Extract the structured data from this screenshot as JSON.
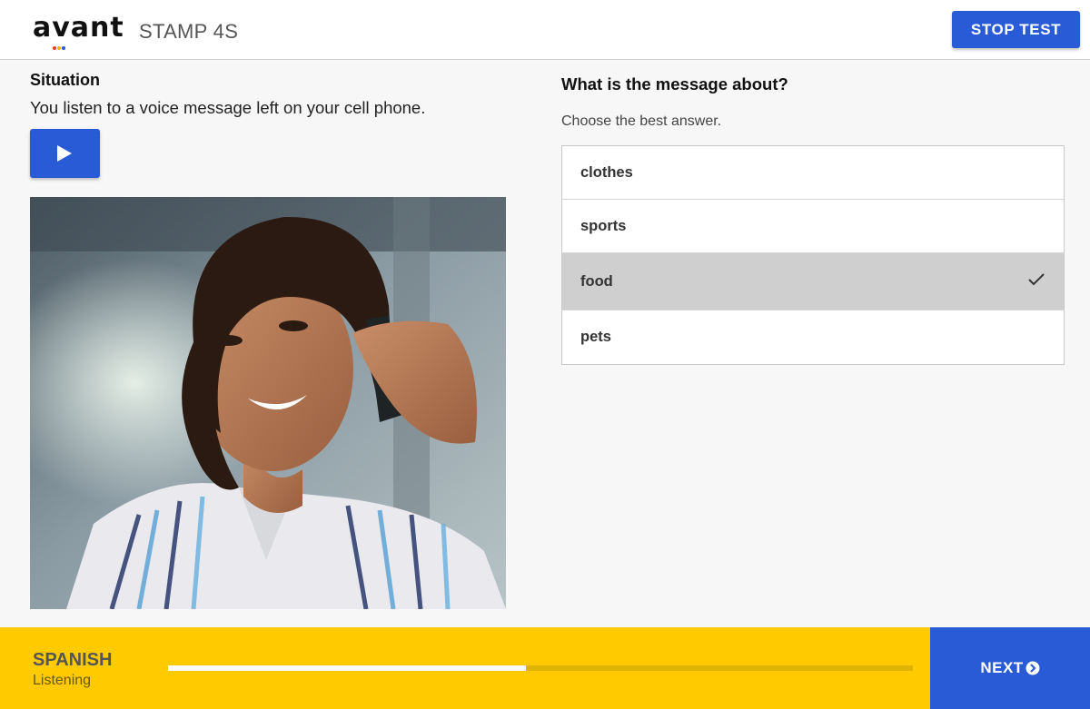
{
  "header": {
    "logo": "avant",
    "product": "STAMP 4S",
    "stop_label": "STOP TEST",
    "logo_dot_colors": [
      "#e63b2e",
      "#f4b400",
      "#2a5bd7"
    ]
  },
  "situation": {
    "title": "Situation",
    "text": "You listen to a voice message left on your cell phone.",
    "play_icon": "play-icon"
  },
  "question": {
    "prompt": "What is the message about?",
    "instruction": "Choose the best answer.",
    "answers": [
      {
        "label": "clothes",
        "selected": false
      },
      {
        "label": "sports",
        "selected": false
      },
      {
        "label": "food",
        "selected": true
      },
      {
        "label": "pets",
        "selected": false
      }
    ]
  },
  "footer": {
    "language": "SPANISH",
    "skill": "Listening",
    "progress": 0.48,
    "next_label": "NEXT",
    "next_icon": "arrow-circle-right-icon"
  },
  "colors": {
    "accent": "#2a5bd7",
    "footer_bg": "#ffcb00",
    "selected_bg": "#cfcfcf"
  }
}
